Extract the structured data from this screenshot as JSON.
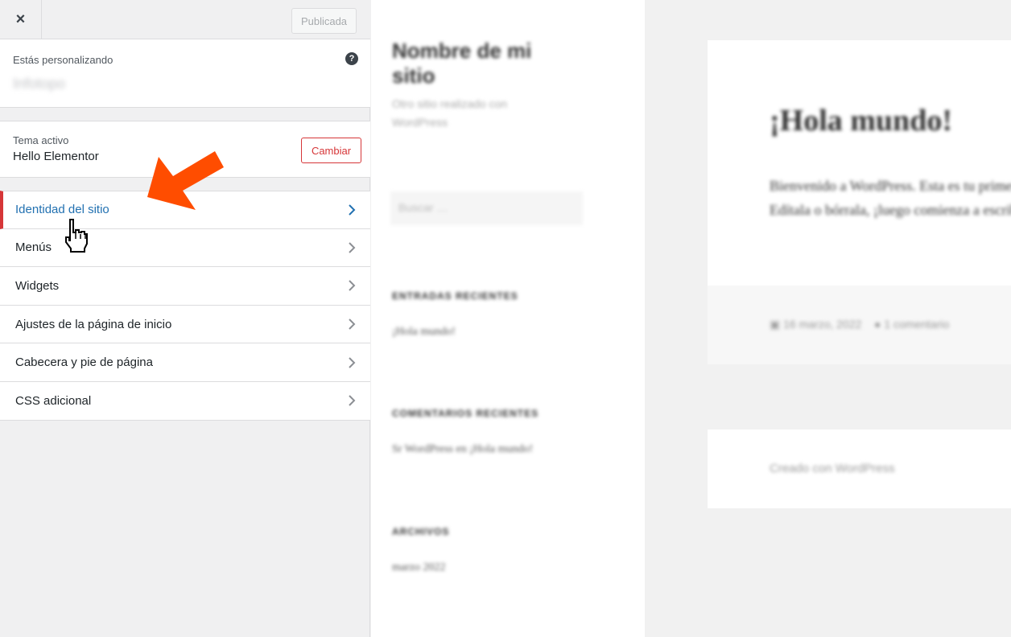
{
  "topbar": {
    "close_icon": "×",
    "publish_label": "Publicada"
  },
  "info": {
    "label": "Estás personalizando",
    "site_name": "Infotopo",
    "help_icon": "?"
  },
  "theme": {
    "label": "Tema activo",
    "name": "Hello Elementor",
    "change_label": "Cambiar"
  },
  "menu": {
    "items": [
      {
        "label": "Identidad del sitio"
      },
      {
        "label": "Menús"
      },
      {
        "label": "Widgets"
      },
      {
        "label": "Ajustes de la página de inicio"
      },
      {
        "label": "Cabecera y pie de página"
      },
      {
        "label": "CSS adicional"
      }
    ]
  },
  "preview": {
    "site_title": "Nombre de mi sitio",
    "site_tagline": "Otro sitio realizado con WordPress",
    "search_placeholder": "Buscar …",
    "recent_posts_heading": "ENTRADAS RECIENTES",
    "recent_post": "¡Hola mundo!",
    "recent_comments_heading": "COMENTARIOS RECIENTES",
    "recent_comment": "Sr WordPress en ¡Hola mundo!",
    "archives_heading": "ARCHIVOS",
    "archive_item": "marzo 2022",
    "post_title": "¡Hola mundo!",
    "post_body": "Bienvenido a WordPress. Esta es tu primera entrada. Edítala o bórrala, ¡luego comienza a escribir!",
    "post_date": "16 marzo, 2022",
    "post_comments": "1 comentario",
    "footer_text": "Creado con WordPress"
  },
  "colors": {
    "accent_red": "#d63638",
    "active_blue": "#2271b1",
    "arrow_orange": "#ff4d00"
  }
}
